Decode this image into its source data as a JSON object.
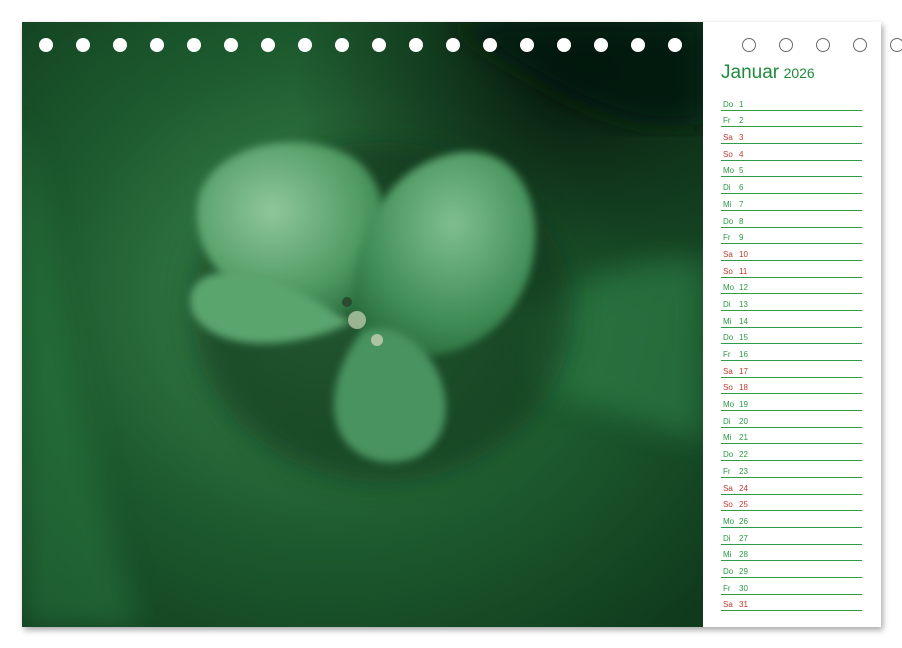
{
  "colors": {
    "accent_green": "#1f8b3c",
    "weekend_red": "#c0392b",
    "rule_green": "#2f9a4a"
  },
  "photo": {
    "subject": "green-leaf-bud-closeup"
  },
  "binding": {
    "filled_holes": 19,
    "ring_holes": 5
  },
  "calendar": {
    "month": "Januar",
    "year": "2026",
    "days": [
      {
        "name": "Do",
        "num": "1",
        "weekend": false
      },
      {
        "name": "Fr",
        "num": "2",
        "weekend": false
      },
      {
        "name": "Sa",
        "num": "3",
        "weekend": true
      },
      {
        "name": "So",
        "num": "4",
        "weekend": true
      },
      {
        "name": "Mo",
        "num": "5",
        "weekend": false
      },
      {
        "name": "Di",
        "num": "6",
        "weekend": false
      },
      {
        "name": "Mi",
        "num": "7",
        "weekend": false
      },
      {
        "name": "Do",
        "num": "8",
        "weekend": false
      },
      {
        "name": "Fr",
        "num": "9",
        "weekend": false
      },
      {
        "name": "Sa",
        "num": "10",
        "weekend": true
      },
      {
        "name": "So",
        "num": "11",
        "weekend": true
      },
      {
        "name": "Mo",
        "num": "12",
        "weekend": false
      },
      {
        "name": "Di",
        "num": "13",
        "weekend": false
      },
      {
        "name": "Mi",
        "num": "14",
        "weekend": false
      },
      {
        "name": "Do",
        "num": "15",
        "weekend": false
      },
      {
        "name": "Fr",
        "num": "16",
        "weekend": false
      },
      {
        "name": "Sa",
        "num": "17",
        "weekend": true
      },
      {
        "name": "So",
        "num": "18",
        "weekend": true
      },
      {
        "name": "Mo",
        "num": "19",
        "weekend": false
      },
      {
        "name": "Di",
        "num": "20",
        "weekend": false
      },
      {
        "name": "Mi",
        "num": "21",
        "weekend": false
      },
      {
        "name": "Do",
        "num": "22",
        "weekend": false
      },
      {
        "name": "Fr",
        "num": "23",
        "weekend": false
      },
      {
        "name": "Sa",
        "num": "24",
        "weekend": true
      },
      {
        "name": "So",
        "num": "25",
        "weekend": true
      },
      {
        "name": "Mo",
        "num": "26",
        "weekend": false
      },
      {
        "name": "Di",
        "num": "27",
        "weekend": false
      },
      {
        "name": "Mi",
        "num": "28",
        "weekend": false
      },
      {
        "name": "Do",
        "num": "29",
        "weekend": false
      },
      {
        "name": "Fr",
        "num": "30",
        "weekend": false
      },
      {
        "name": "Sa",
        "num": "31",
        "weekend": true
      }
    ]
  }
}
